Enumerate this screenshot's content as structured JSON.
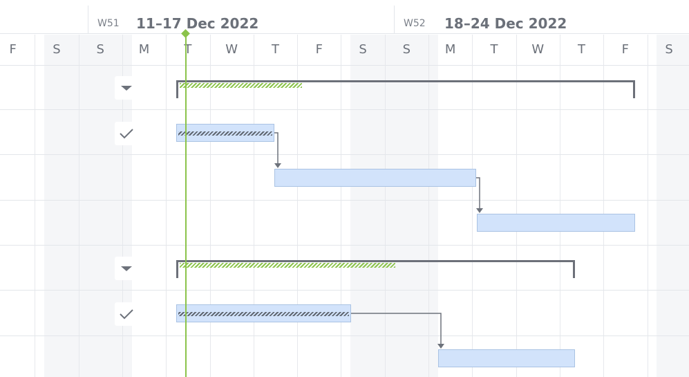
{
  "colors": {
    "today_line": "#8bc34a",
    "bar_fill": "#d2e3fb",
    "bar_border": "#a9c2e3",
    "summary_bracket": "#6c7079",
    "weekend_bg": "#f5f6f8",
    "connector": "#6d727b"
  },
  "timeline": {
    "weeks": [
      {
        "label": "W51",
        "range": "11–17 Dec 2022"
      },
      {
        "label": "W52",
        "range": "18–24 Dec 2022"
      }
    ],
    "days": [
      "F",
      "S",
      "S",
      "M",
      "T",
      "W",
      "T",
      "F",
      "S",
      "S",
      "M",
      "T",
      "W",
      "T",
      "F",
      "S"
    ],
    "weekend_days": [
      1,
      2,
      8,
      9,
      15
    ],
    "today_day_index": 4
  },
  "rows": [
    {
      "kind": "summary",
      "icon": "caret-down-icon",
      "progress": 0.27
    },
    {
      "kind": "task",
      "icon": "check-icon",
      "progress": 1.0
    },
    {
      "kind": "task",
      "icon": "",
      "progress": 0
    },
    {
      "kind": "task",
      "icon": "",
      "progress": 0
    },
    {
      "kind": "summary",
      "icon": "caret-down-icon",
      "progress": 0.55
    },
    {
      "kind": "task",
      "icon": "check-icon",
      "progress": 1.0
    },
    {
      "kind": "task",
      "icon": "",
      "progress": 0
    }
  ]
}
